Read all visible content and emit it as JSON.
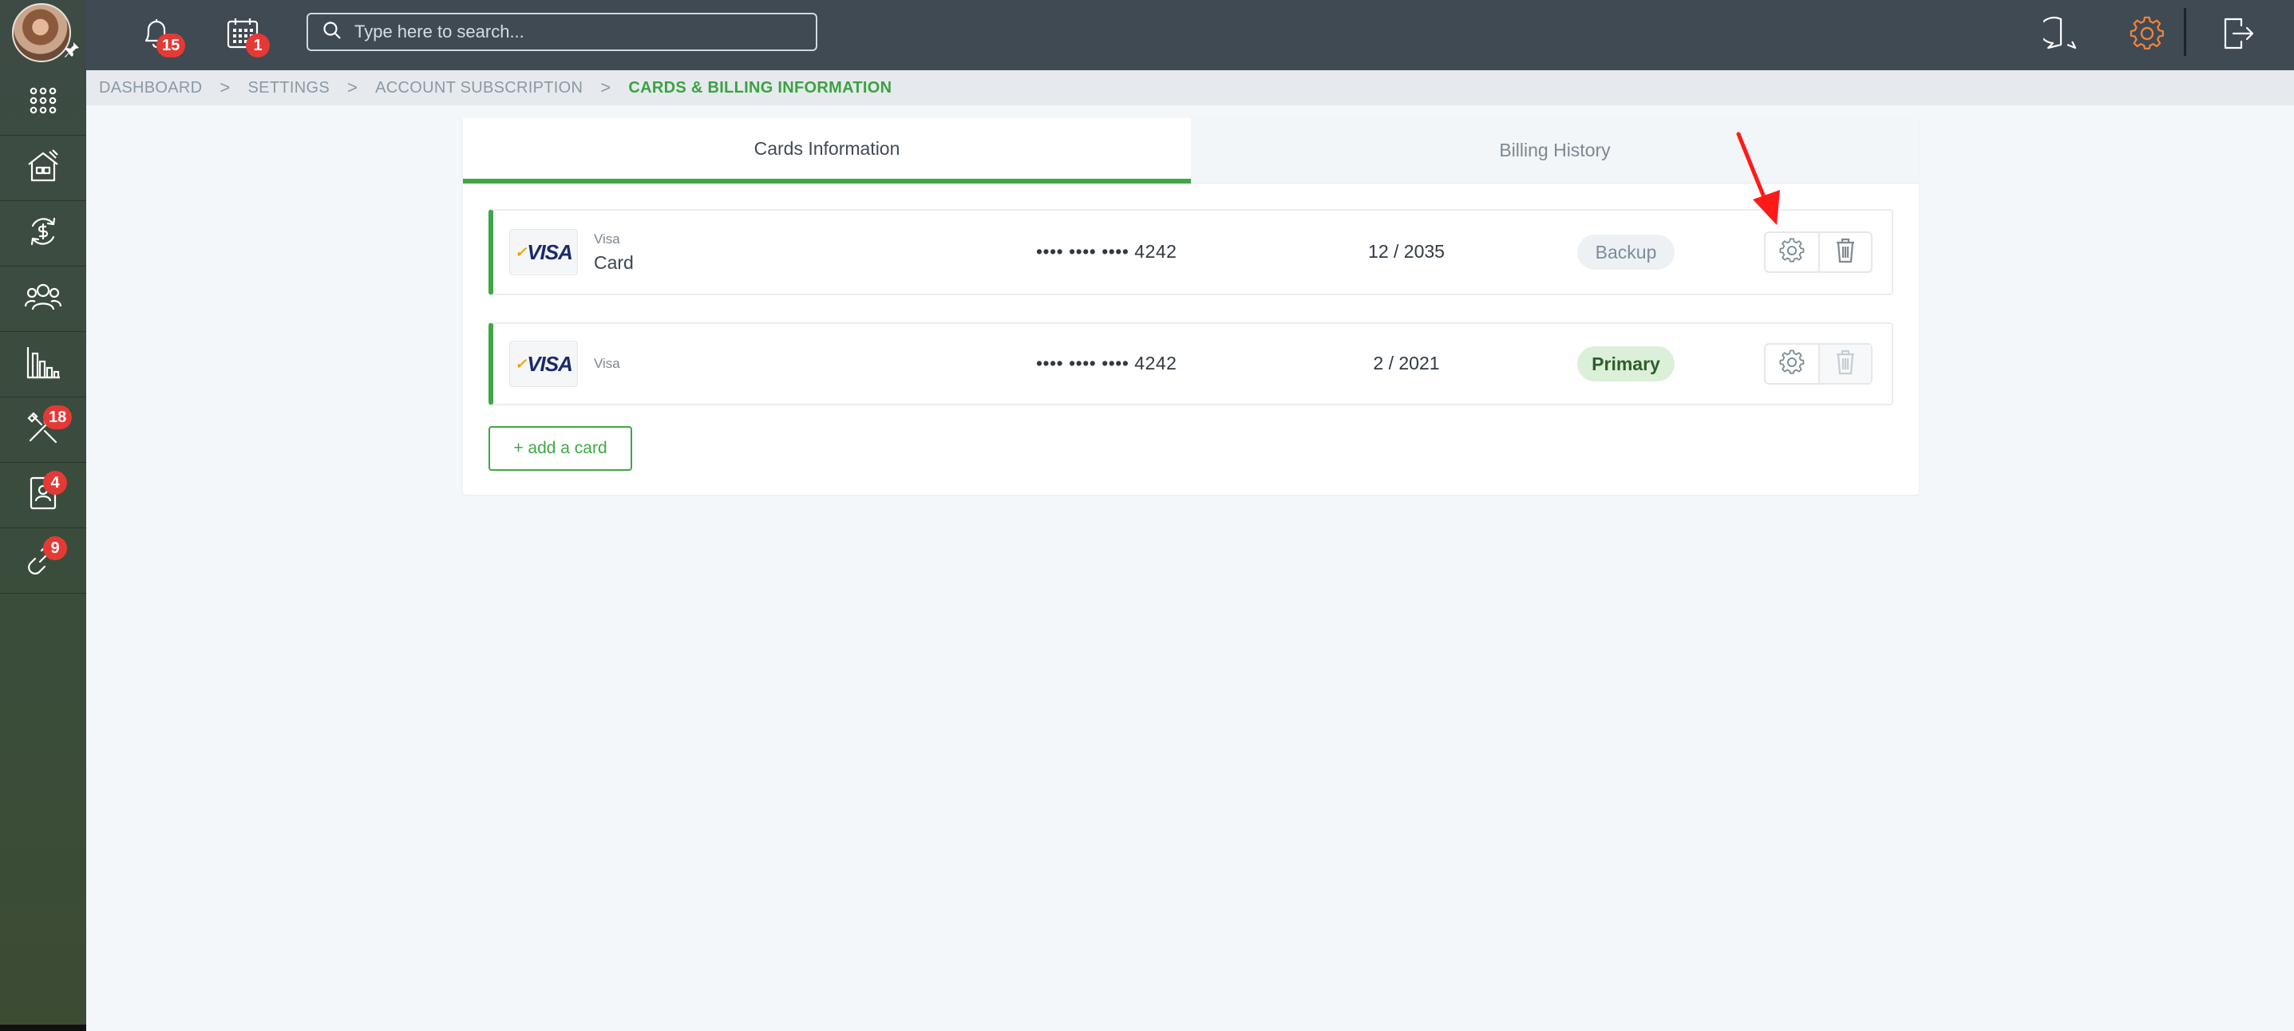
{
  "topbar": {
    "notifications_count": "15",
    "calendar_count": "1",
    "search_placeholder": "Type here to search..."
  },
  "sidebar": {
    "items": [
      {
        "icon": "apps-grid-icon",
        "badge": ""
      },
      {
        "icon": "house-icon",
        "badge": ""
      },
      {
        "icon": "money-cycle-icon",
        "badge": ""
      },
      {
        "icon": "users-icon",
        "badge": ""
      },
      {
        "icon": "bar-chart-icon",
        "badge": ""
      },
      {
        "icon": "tools-icon",
        "badge": "18"
      },
      {
        "icon": "contact-card-icon",
        "badge": "4"
      },
      {
        "icon": "link-icon",
        "badge": "9"
      }
    ]
  },
  "breadcrumb": {
    "items": [
      "DASHBOARD",
      "SETTINGS",
      "ACCOUNT SUBSCRIPTION"
    ],
    "current": "CARDS & BILLING INFORMATION",
    "separator": ">"
  },
  "tabs": {
    "cards": "Cards Information",
    "billing": "Billing History"
  },
  "cards": [
    {
      "logo": "VISA",
      "brand": "Visa",
      "name": "Card",
      "number": "•••• •••• •••• 4242",
      "expiry": "12 / 2035",
      "status": "Backup"
    },
    {
      "logo": "VISA",
      "brand": "Visa",
      "name": "",
      "number": "•••• •••• •••• 4242",
      "expiry": "2 / 2021",
      "status": "Primary"
    }
  ],
  "add_card_label": "+ add a card",
  "colors": {
    "accent_green": "#3ea744",
    "topbar": "#3f4a53",
    "badge_red": "#e53935",
    "settings_orange": "#f0833a",
    "annotation_red": "#ff1a1a"
  }
}
